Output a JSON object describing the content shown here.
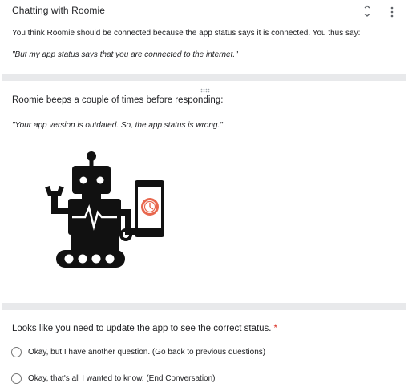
{
  "section": {
    "title": "Chatting with Roomie",
    "description": "You think Roomie should be connected because the app status says it is connected. You thus say:",
    "quote": "\"But my app status says that you are connected to the internet.\""
  },
  "item": {
    "text": "Roomie beeps a couple of times before responding:",
    "quote": "\"Your app version is outdated. So, the app status is wrong.\"",
    "image_alt": "Robot with phone showing clock icon"
  },
  "question": {
    "label": "Looks like you need to update the app to see the correct status.",
    "required_mark": "*",
    "options": [
      {
        "label": "Okay, but I have another question. (Go back to previous questions)"
      },
      {
        "label": "Okay, that's all I wanted to know. (End Conversation)"
      }
    ]
  },
  "icons": {
    "collapse": "collapse-icon",
    "more": "more-vert-icon",
    "drag": "drag-handle-icon"
  },
  "colors": {
    "required": "#d93025",
    "divider": "#e8e9eb",
    "clock": "#e8674e"
  }
}
